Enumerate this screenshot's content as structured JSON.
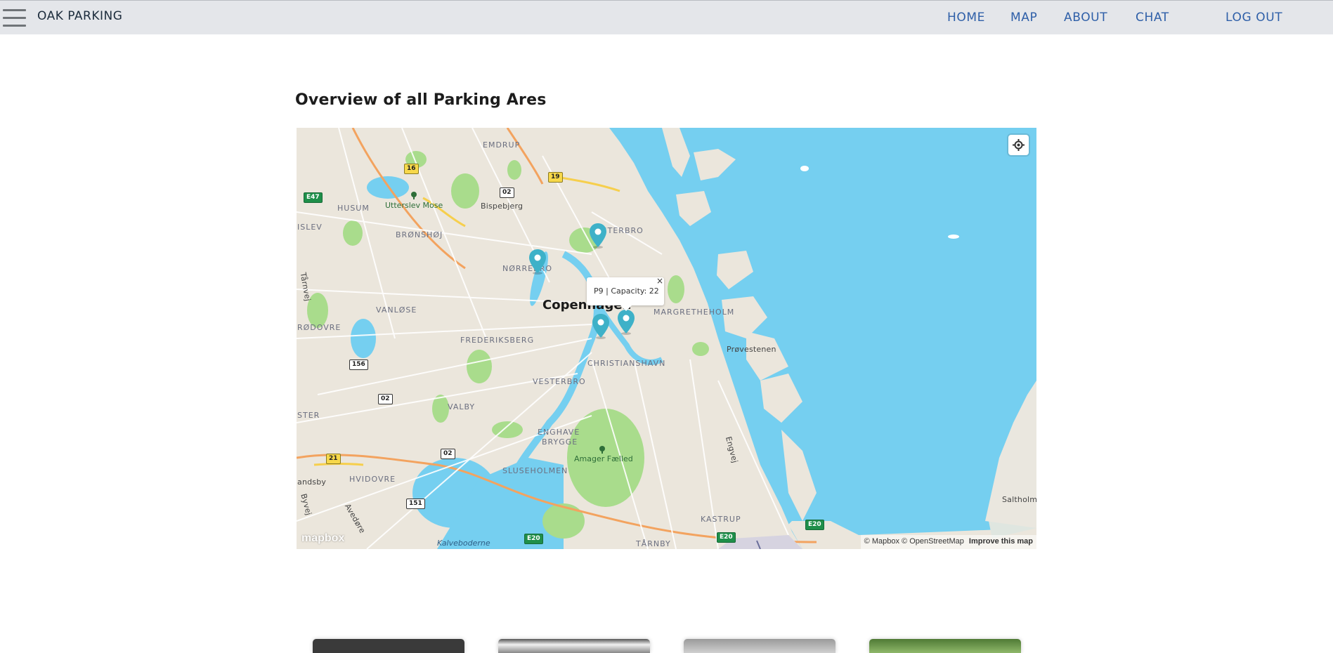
{
  "brand": "OAK PARKING",
  "nav": {
    "home": "HOME",
    "map": "MAP",
    "about": "ABOUT",
    "chat": "CHAT",
    "logout": "LOG OUT"
  },
  "page_title": "Overview of all Parking Ares",
  "map": {
    "labels": {
      "emdrup": "EMDRUP",
      "husum": "HUSUM",
      "utterslev": "Utterslev Mose",
      "bispebjerg": "Bispebjerg",
      "bronshoj": "BRØNSHØJ",
      "islev": "ISLEV",
      "osterbro": "ØSTERBRO",
      "norrebro": "NØRREBRO",
      "copenhagen": "Copenhagen",
      "vanlose": "VANLØSE",
      "rodovre": "RØDOVRE",
      "frederiksberg": "FREDERIKSBERG",
      "margretheholm": "MARGRETHEHOLM",
      "provestenen": "Prøvestenen",
      "christianshavn": "CHRISTIANSHAVN",
      "vesterbro": "VESTERBRO",
      "valby": "VALBY",
      "ster": "STER",
      "enghave": "ENGHAVE",
      "brygge": "BRYGGE",
      "amager": "Amager Fælled",
      "engvej": "Engvej",
      "sluseholmen": "SLUSEHOLMEN",
      "hvidovre": "HVIDOVRE",
      "andsby": "andsby",
      "byvej": "Byvej",
      "avedore": "Avedøre",
      "tarnvej": "Tårnvej",
      "kastrup": "KASTRUP",
      "tarnby": "TÅRNBY",
      "kalveboderne": "Kalveboderne",
      "saltholm": "Saltholm"
    },
    "shields": {
      "r16": "16",
      "r19": "19",
      "r02a": "02",
      "e47": "E47",
      "r156": "156",
      "r02b": "02",
      "r02c": "02",
      "r21": "21",
      "r151": "151",
      "e20a": "E20",
      "e20b": "E20",
      "e20c": "E20"
    },
    "popup_text": "P9 | Capacity: 22",
    "popup_close": "×",
    "attribution_mapbox": "© Mapbox",
    "attribution_osm": "© OpenStreetMap",
    "improve": "Improve this map",
    "logo": "mapbox",
    "colors": {
      "water": "#75cff0",
      "land": "#ebe6dc",
      "park": "#a9dc8c",
      "marker": "#3eb1c8"
    }
  }
}
